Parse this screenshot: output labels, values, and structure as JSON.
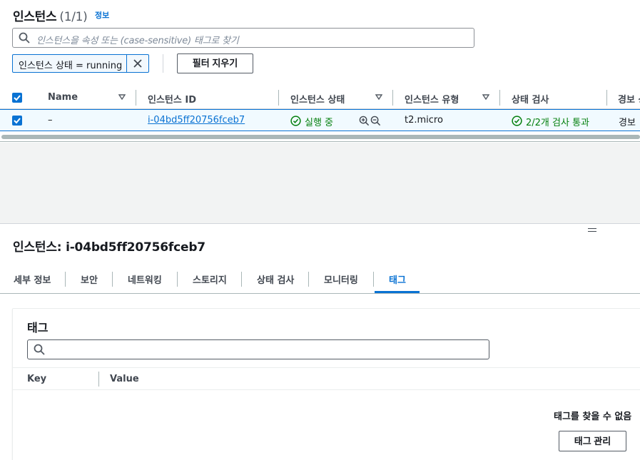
{
  "instances": {
    "title": "인스턴스",
    "count": "(1/1)",
    "info_link": "정보",
    "search_placeholder": "인스턴스을 속성 또는 (case-sensitive) 태그로 찾기",
    "filter_token": "인스턴스 상태 = running",
    "clear_filters_label": "필터 지우기",
    "columns": [
      "Name",
      "인스턴스 ID",
      "인스턴스 상태",
      "인스턴스 유형",
      "상태 검사",
      "경보 상"
    ],
    "row": {
      "name": "–",
      "instance_id": "i-04bd5ff20756fceb7",
      "state": "실행 중",
      "type": "t2.micro",
      "status_check": "2/2개 검사 통과",
      "alarm": "경보"
    }
  },
  "detail": {
    "title": "인스턴스: i-04bd5ff20756fceb7",
    "tabs": [
      "세부 정보",
      "보안",
      "네트워킹",
      "스토리지",
      "상태 검사",
      "모니터링",
      "태그"
    ],
    "active_tab": "태그",
    "tags_panel": {
      "title": "태그",
      "search_placeholder": "",
      "col_key": "Key",
      "col_value": "Value",
      "empty_message": "태그를 찾을 수 없음",
      "manage_label": "태그 관리"
    }
  },
  "colors": {
    "primary": "#0972d3",
    "success": "#037f0c",
    "selected_row_bg": "#f1faff",
    "gap_bg": "#f2f3f3"
  }
}
